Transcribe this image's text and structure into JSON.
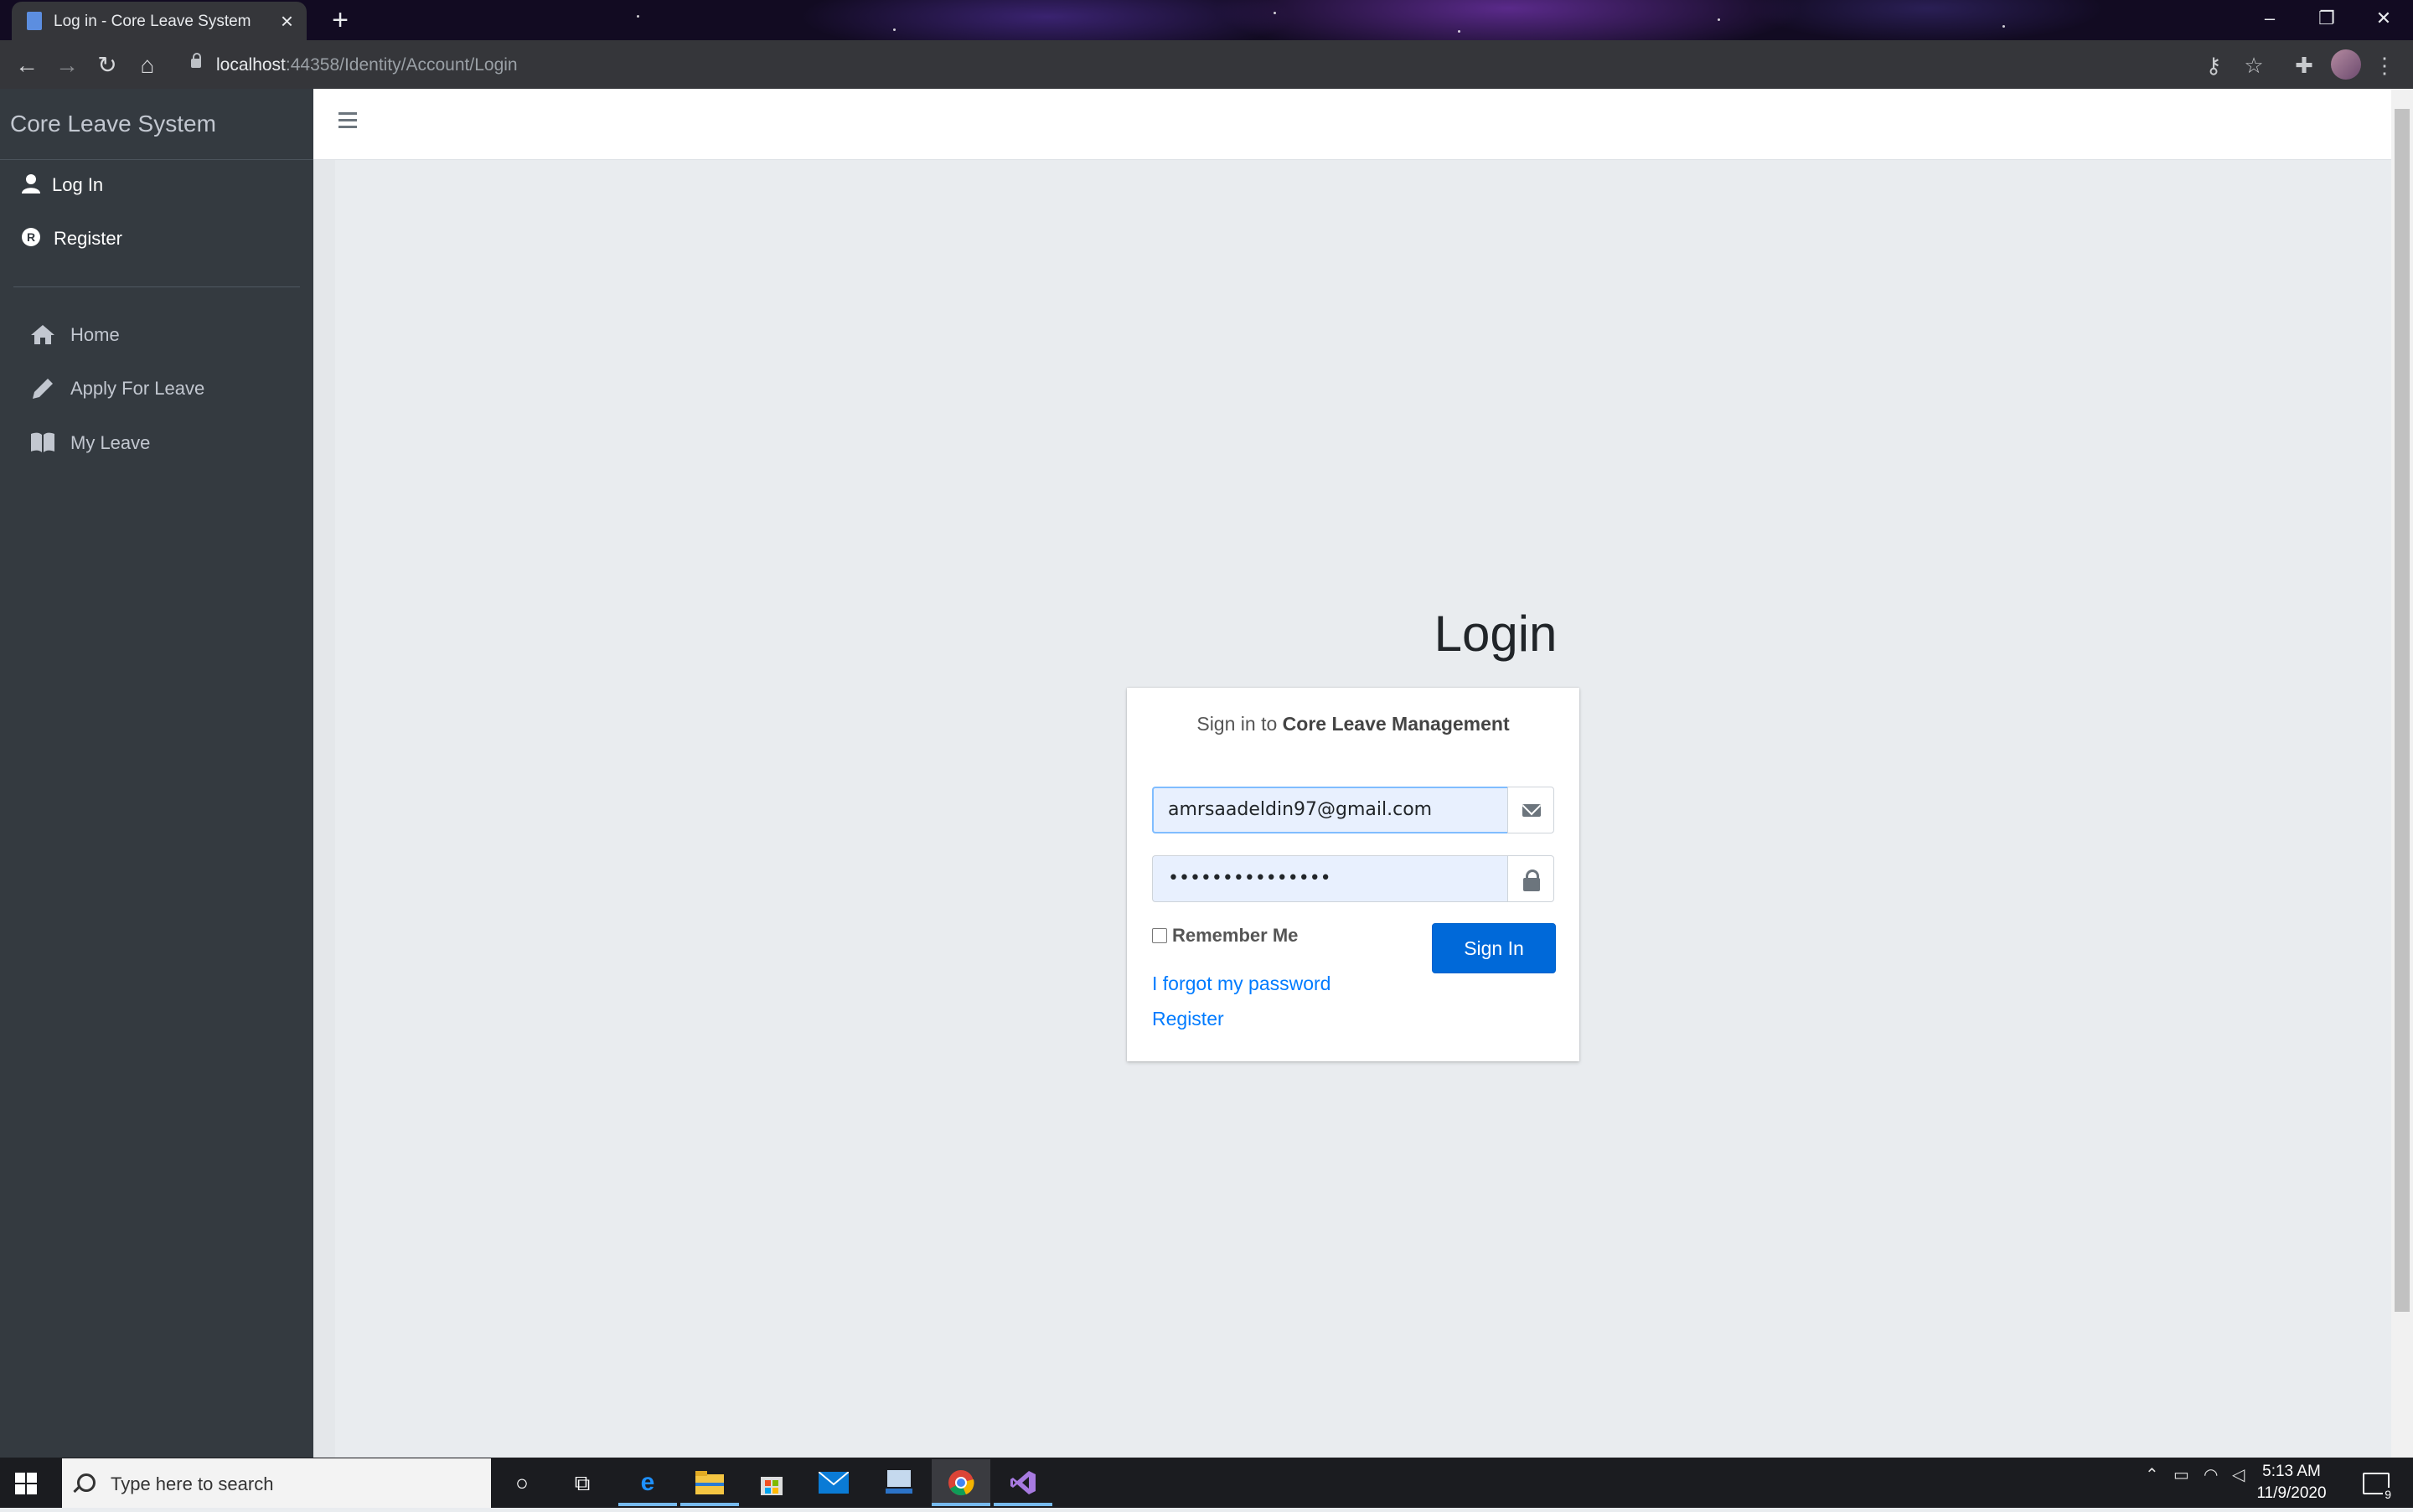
{
  "browser": {
    "tab_title": "Log in - Core Leave System",
    "new_tab": "+",
    "tab_close": "×",
    "url_host": "localhost",
    "url_rest": ":44358/Identity/Account/Login",
    "window_controls": [
      "–",
      "❐",
      "✕"
    ]
  },
  "sidebar": {
    "brand": "Core Leave System",
    "auth_items": [
      {
        "label": "Log In",
        "icon": "user-icon"
      },
      {
        "label": "Register",
        "icon": "registered-icon"
      }
    ],
    "nav_items": [
      {
        "label": "Home",
        "icon": "home-icon"
      },
      {
        "label": "Apply For Leave",
        "icon": "pencil-icon"
      },
      {
        "label": "My Leave",
        "icon": "book-icon"
      }
    ]
  },
  "login": {
    "title": "Login",
    "message_prefix": "Sign in to",
    "message_app": "Core Leave Management",
    "email_value": "amrsaadeldin97@gmail.com",
    "password_value": "•••••••••••••••",
    "remember_label": "Remember Me",
    "remember_checked": false,
    "signin_label": "Sign In",
    "forgot_link": "I forgot my password",
    "register_link": "Register"
  },
  "taskbar": {
    "search_placeholder": "Type here to search",
    "time": "5:13 AM",
    "date": "11/9/2020",
    "notification_count": "9"
  },
  "colors": {
    "sidebar_bg": "#343a40",
    "primary": "#007bff",
    "button": "#0069d9",
    "content_bg": "#e9ecef"
  }
}
